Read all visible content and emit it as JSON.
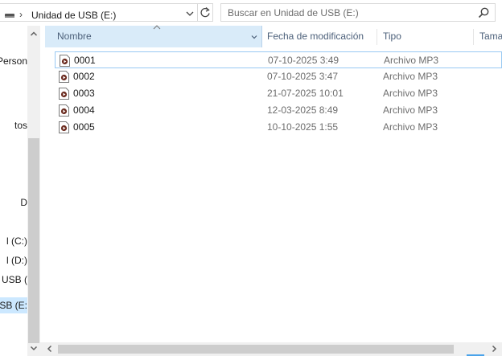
{
  "address_bar": {
    "breadcrumb": "Unidad de USB (E:)",
    "separator": "›"
  },
  "search": {
    "placeholder": "Buscar en Unidad de USB (E:)"
  },
  "nav_pane": {
    "items": [
      {
        "label": "Person",
        "selected": false
      },
      {
        "label": "tos",
        "selected": false
      },
      {
        "label": "D",
        "selected": false
      },
      {
        "label": "l (C:)",
        "selected": false
      },
      {
        "label": "l (D:)",
        "selected": false
      },
      {
        "label": "e USB (",
        "selected": false
      },
      {
        "label": "USB (E:",
        "selected": true
      }
    ]
  },
  "columns": {
    "name": "Nombre",
    "date": "Fecha de modificación",
    "type": "Tipo",
    "size": "Tama"
  },
  "files": [
    {
      "name": "0001",
      "date": "07-10-2025 3:49",
      "type": "Archivo MP3"
    },
    {
      "name": "0002",
      "date": "07-10-2025 3:47",
      "type": "Archivo MP3"
    },
    {
      "name": "0003",
      "date": "21-07-2025 10:01",
      "type": "Archivo MP3"
    },
    {
      "name": "0004",
      "date": "12-03-2025 8:49",
      "type": "Archivo MP3"
    },
    {
      "name": "0005",
      "date": "10-10-2025 1:55",
      "type": "Archivo MP3"
    }
  ],
  "icons": {
    "drive": "usb-drive-icon",
    "refresh": "refresh-icon",
    "search": "search-icon",
    "file": "mp3-file-icon"
  }
}
